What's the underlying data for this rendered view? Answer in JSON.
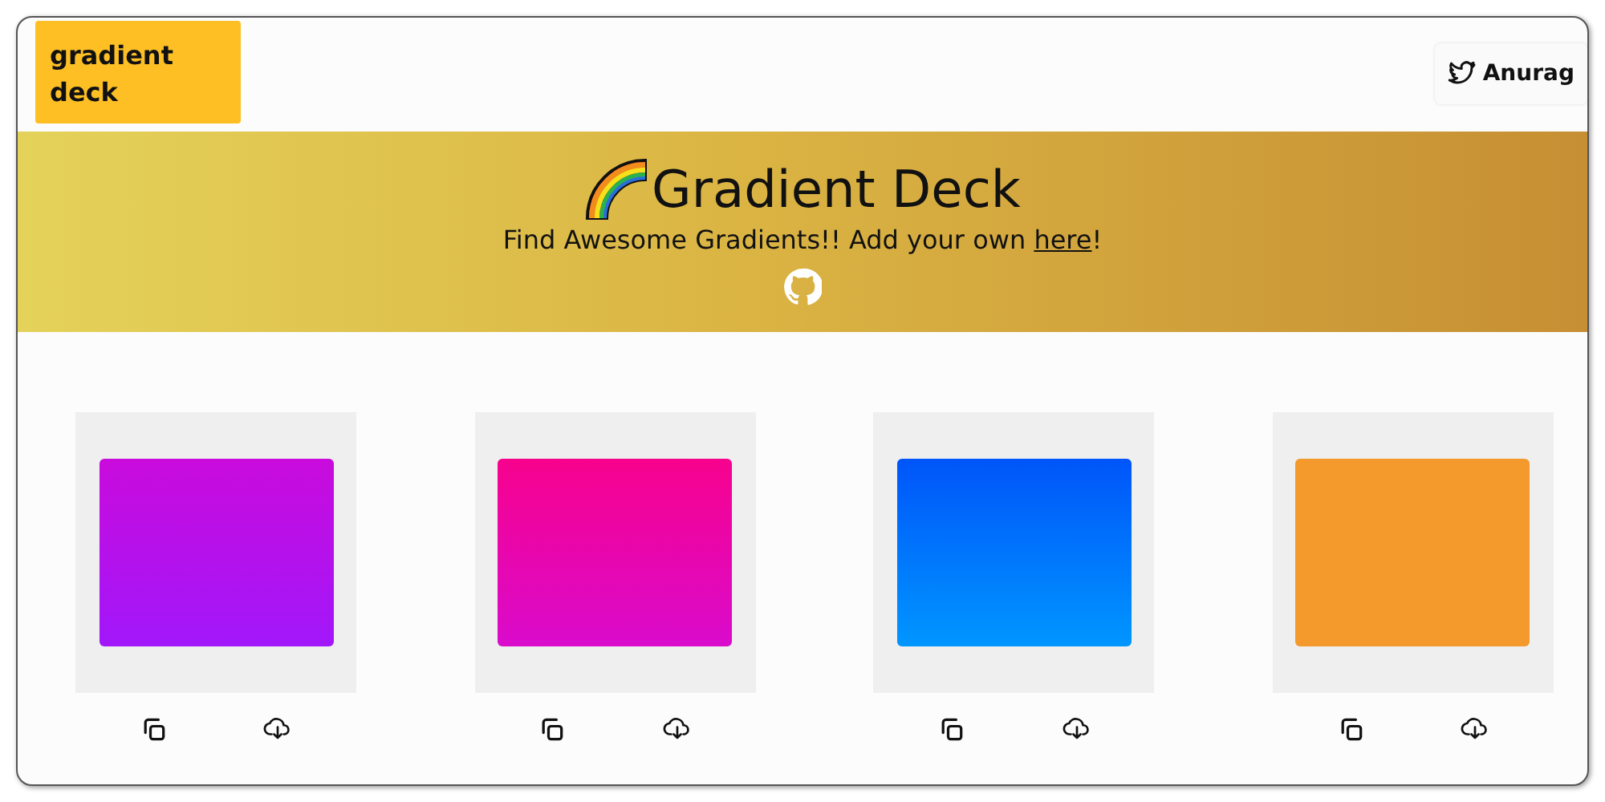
{
  "logo": {
    "text": "gradient deck"
  },
  "profile_link": {
    "label": "Anurag"
  },
  "hero": {
    "title": "Gradient Deck",
    "subtitle_start": "Find Awesome Gradients!! Add your own ",
    "link": "here",
    "subtitle_end": "!"
  },
  "cards": [
    {
      "stops": [
        {
          "color": "#c90bdc"
        },
        {
          "color": "#a117fa"
        }
      ]
    },
    {
      "stops": [
        {
          "color": "#f7028d"
        },
        {
          "color": "#d90bcc"
        }
      ]
    },
    {
      "stops": [
        {
          "color": "#0055f9"
        },
        {
          "color": "#0096ff"
        }
      ]
    },
    {
      "stops": [
        {
          "color": "#f4992b"
        },
        {
          "color": "#f4992b"
        }
      ]
    }
  ]
}
